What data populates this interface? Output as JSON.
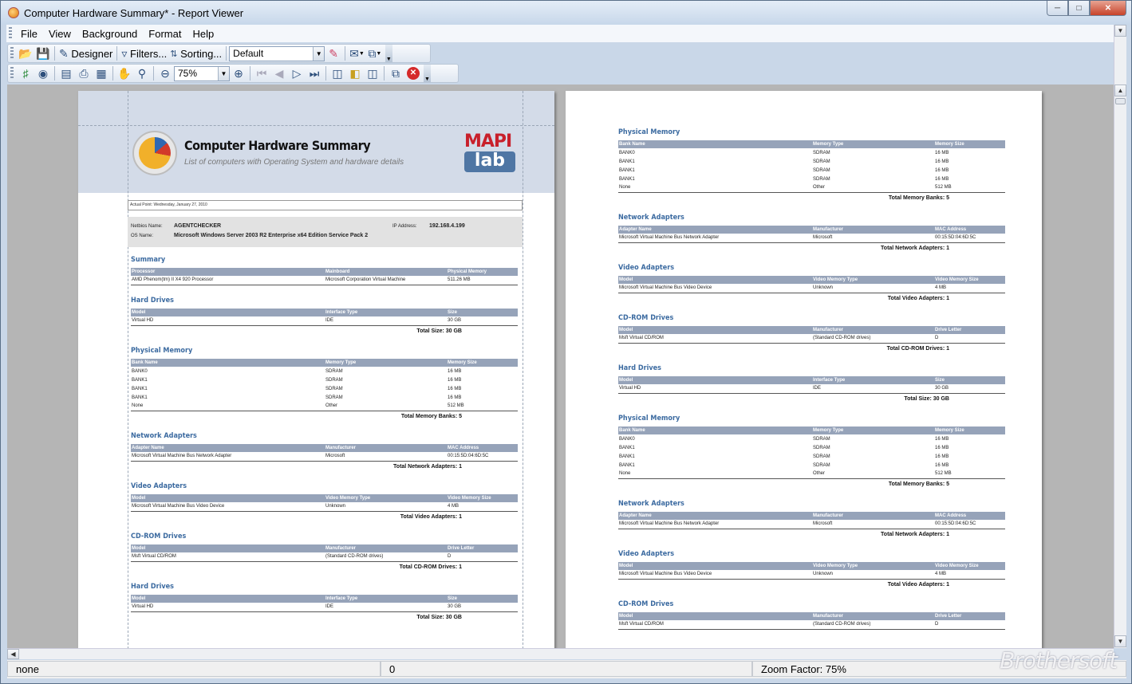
{
  "window": {
    "title": "Computer Hardware Summary* - Report Viewer"
  },
  "menu": [
    "File",
    "View",
    "Background",
    "Format",
    "Help"
  ],
  "toolbar1": {
    "designer": "Designer",
    "filters": "Filters...",
    "sorting": "Sorting...",
    "style_value": "Default"
  },
  "toolbar2": {
    "zoom_value": "75%"
  },
  "status": {
    "left": "none",
    "middle": "0",
    "right": "Zoom Factor: 75%"
  },
  "watermark": "Brothersoft",
  "report": {
    "title": "Computer Hardware Summary",
    "subtitle": "List of computers with Operating System and hardware details",
    "logo_top": "MAPI",
    "logo_bottom": "lab",
    "printed": "Actual Point: Wednesday, January 27, 2010",
    "netbios_label": "Netbios Name:",
    "netbios_value": "AGENTCHECKER",
    "os_label": "OS Name:",
    "os_value": "Microsoft Windows Server 2003 R2 Enterprise x64 Edition Service Pack 2",
    "ip_label": "IP Address:",
    "ip_value": "192.168.4.199"
  },
  "page1": [
    {
      "title": "Summary",
      "cols": [
        "Processor",
        "Mainboard",
        "Physical Memory"
      ],
      "rows": [
        [
          "AMD Phenom(tm) II X4 920 Processor",
          "Microsoft Corporation Virtual Machine",
          "511.26 MB"
        ]
      ],
      "total": ""
    },
    {
      "title": "Hard Drives",
      "cols": [
        "Model",
        "Interface Type",
        "Size"
      ],
      "rows": [
        [
          "Virtual HD",
          "IDE",
          "30 GB"
        ]
      ],
      "total": "Total Size: 30 GB"
    },
    {
      "title": "Physical Memory",
      "cols": [
        "Bank Name",
        "Memory Type",
        "Memory Size"
      ],
      "rows": [
        [
          "BANK0",
          "SDRAM",
          "16 MB"
        ],
        [
          "BANK1",
          "SDRAM",
          "16 MB"
        ],
        [
          "BANK1",
          "SDRAM",
          "16 MB"
        ],
        [
          "BANK1",
          "SDRAM",
          "16 MB"
        ],
        [
          "None",
          "Other",
          "512 MB"
        ]
      ],
      "total": "Total Memory Banks: 5"
    },
    {
      "title": "Network Adapters",
      "cols": [
        "Adapter Name",
        "Manufacturer",
        "MAC Address"
      ],
      "rows": [
        [
          "Microsoft Virtual Machine Bus Network Adapter",
          "Microsoft",
          "00:15:5D:04:6D:5C"
        ]
      ],
      "total": "Total Network Adapters: 1"
    },
    {
      "title": "Video Adapters",
      "cols": [
        "Model",
        "Video Memory Type",
        "Video Memory Size"
      ],
      "rows": [
        [
          "Microsoft Virtual Machine Bus Video Device",
          "Unknown",
          "4 MB"
        ]
      ],
      "total": "Total Video Adapters: 1"
    },
    {
      "title": "CD-ROM Drives",
      "cols": [
        "Model",
        "Manufacturer",
        "Drive Letter"
      ],
      "rows": [
        [
          "Msft Virtual CD/ROM",
          "(Standard CD-ROM drives)",
          "D"
        ]
      ],
      "total": "Total CD-ROM Drives: 1"
    },
    {
      "title": "Hard Drives",
      "cols": [
        "Model",
        "Interface Type",
        "Size"
      ],
      "rows": [
        [
          "Virtual HD",
          "IDE",
          "30 GB"
        ]
      ],
      "total": "Total Size: 30 GB"
    }
  ],
  "page2": [
    {
      "title": "Physical Memory",
      "cols": [
        "Bank Name",
        "Memory Type",
        "Memory Size"
      ],
      "rows": [
        [
          "BANK0",
          "SDRAM",
          "16 MB"
        ],
        [
          "BANK1",
          "SDRAM",
          "16 MB"
        ],
        [
          "BANK1",
          "SDRAM",
          "16 MB"
        ],
        [
          "BANK1",
          "SDRAM",
          "16 MB"
        ],
        [
          "None",
          "Other",
          "512 MB"
        ]
      ],
      "total": "Total Memory Banks: 5"
    },
    {
      "title": "Network Adapters",
      "cols": [
        "Adapter Name",
        "Manufacturer",
        "MAC Address"
      ],
      "rows": [
        [
          "Microsoft Virtual Machine Bus Network Adapter",
          "Microsoft",
          "00:15:5D:04:6D:5C"
        ]
      ],
      "total": "Total Network Adapters: 1"
    },
    {
      "title": "Video Adapters",
      "cols": [
        "Model",
        "Video Memory Type",
        "Video Memory Size"
      ],
      "rows": [
        [
          "Microsoft Virtual Machine Bus Video Device",
          "Unknown",
          "4 MB"
        ]
      ],
      "total": "Total Video Adapters: 1"
    },
    {
      "title": "CD-ROM Drives",
      "cols": [
        "Model",
        "Manufacturer",
        "Drive Letter"
      ],
      "rows": [
        [
          "Msft Virtual CD/ROM",
          "(Standard CD-ROM drives)",
          "D"
        ]
      ],
      "total": "Total CD-ROM Drives: 1"
    },
    {
      "title": "Hard Drives",
      "cols": [
        "Model",
        "Interface Type",
        "Size"
      ],
      "rows": [
        [
          "Virtual HD",
          "IDE",
          "30 GB"
        ]
      ],
      "total": "Total Size: 30 GB"
    },
    {
      "title": "Physical Memory",
      "cols": [
        "Bank Name",
        "Memory Type",
        "Memory Size"
      ],
      "rows": [
        [
          "BANK0",
          "SDRAM",
          "16 MB"
        ],
        [
          "BANK1",
          "SDRAM",
          "16 MB"
        ],
        [
          "BANK1",
          "SDRAM",
          "16 MB"
        ],
        [
          "BANK1",
          "SDRAM",
          "16 MB"
        ],
        [
          "None",
          "Other",
          "512 MB"
        ]
      ],
      "total": "Total Memory Banks: 5"
    },
    {
      "title": "Network Adapters",
      "cols": [
        "Adapter Name",
        "Manufacturer",
        "MAC Address"
      ],
      "rows": [
        [
          "Microsoft Virtual Machine Bus Network Adapter",
          "Microsoft",
          "00:15:5D:04:6D:5C"
        ]
      ],
      "total": "Total Network Adapters: 1"
    },
    {
      "title": "Video Adapters",
      "cols": [
        "Model",
        "Video Memory Type",
        "Video Memory Size"
      ],
      "rows": [
        [
          "Microsoft Virtual Machine Bus Video Device",
          "Unknown",
          "4 MB"
        ]
      ],
      "total": "Total Video Adapters: 1"
    },
    {
      "title": "CD-ROM Drives",
      "cols": [
        "Model",
        "Manufacturer",
        "Drive Letter"
      ],
      "rows": [
        [
          "Msft Virtual CD/ROM",
          "(Standard CD-ROM drives)",
          "D"
        ]
      ],
      "total": ""
    }
  ]
}
